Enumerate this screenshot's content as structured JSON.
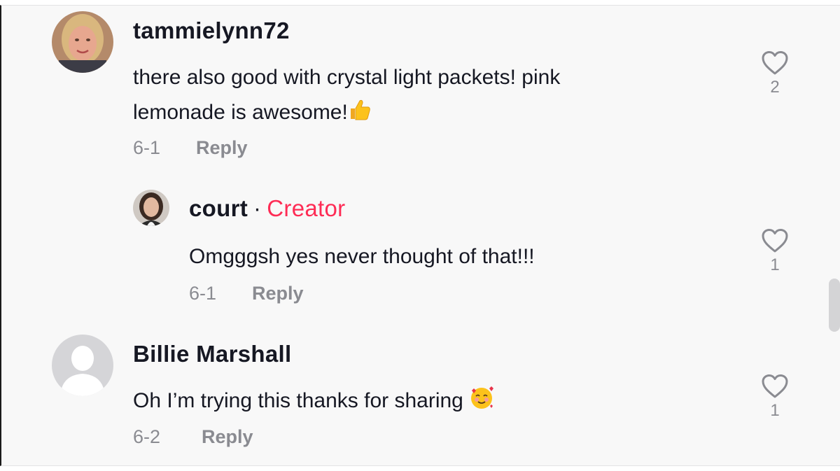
{
  "comments": [
    {
      "username": "tammielynn72",
      "text_lines": [
        "there also good with crystal light packets! pink",
        "lemonade is awesome!"
      ],
      "emoji": "thumbs-up-icon",
      "date": "6-1",
      "reply_label": "Reply",
      "likes": "2"
    },
    {
      "username": "court",
      "separator": "·",
      "badge": "Creator",
      "text": "Omgggsh yes never thought of that!!!",
      "date": "6-1",
      "reply_label": "Reply",
      "likes": "1"
    },
    {
      "username": "Billie Marshall",
      "text": "Oh I’m trying this thanks for sharing",
      "emoji": "smiling-face-with-hearts-icon",
      "date": "6-2",
      "reply_label": "Reply",
      "likes": "1"
    }
  ],
  "colors": {
    "background": "#f8f8f8",
    "creator_badge": "#fe2c55",
    "muted": "#8a8b91",
    "text": "#161823"
  }
}
